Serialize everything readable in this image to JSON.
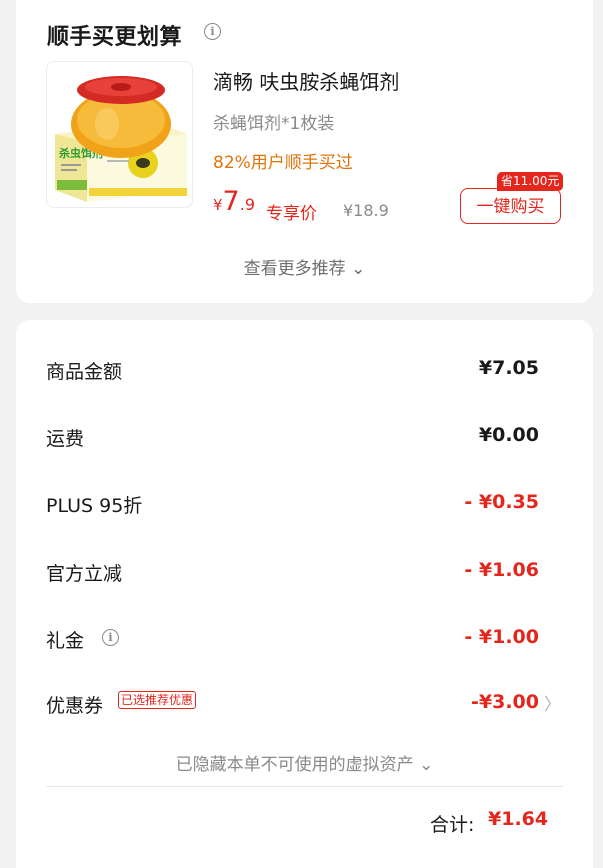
{
  "recommend": {
    "title": "顺手买更划算",
    "info_icon": "ⓘ",
    "product": {
      "name": "滴畅 呋虫胺杀蝇饵剂",
      "spec": "杀蝇饵剂*1枚装",
      "buyers": "82%用户顺手买过",
      "price_currency": "¥",
      "price_integer": "7",
      "price_decimal": ".9",
      "price_tag": "专享价",
      "original_price": "¥18.9",
      "save_badge": "省11.00元",
      "buy_button": "一键购买",
      "box_label": "杀虫饵剂"
    },
    "more_label": "查看更多推荐 ⌄"
  },
  "order": {
    "rows": [
      {
        "label": "商品金额",
        "value": "¥7.05"
      },
      {
        "label": "运费",
        "value": "¥0.00"
      },
      {
        "label": "PLUS 95折",
        "value": "- ¥0.35"
      },
      {
        "label": "官方立减",
        "value": "- ¥1.06"
      },
      {
        "label": "礼金",
        "value": "- ¥1.00"
      },
      {
        "label": "优惠券",
        "value": "-¥3.00"
      }
    ],
    "coupon_tag": "已选推荐优惠",
    "chevron": "〉",
    "hidden_assets_label": "已隐藏本单不可使用的虚拟资产 ⌄",
    "total_label": "合计:",
    "total_value": "¥1.64"
  },
  "colors": {
    "accent": "#e4261c",
    "orange": "#e0740b",
    "background": "#f2f2f2"
  }
}
